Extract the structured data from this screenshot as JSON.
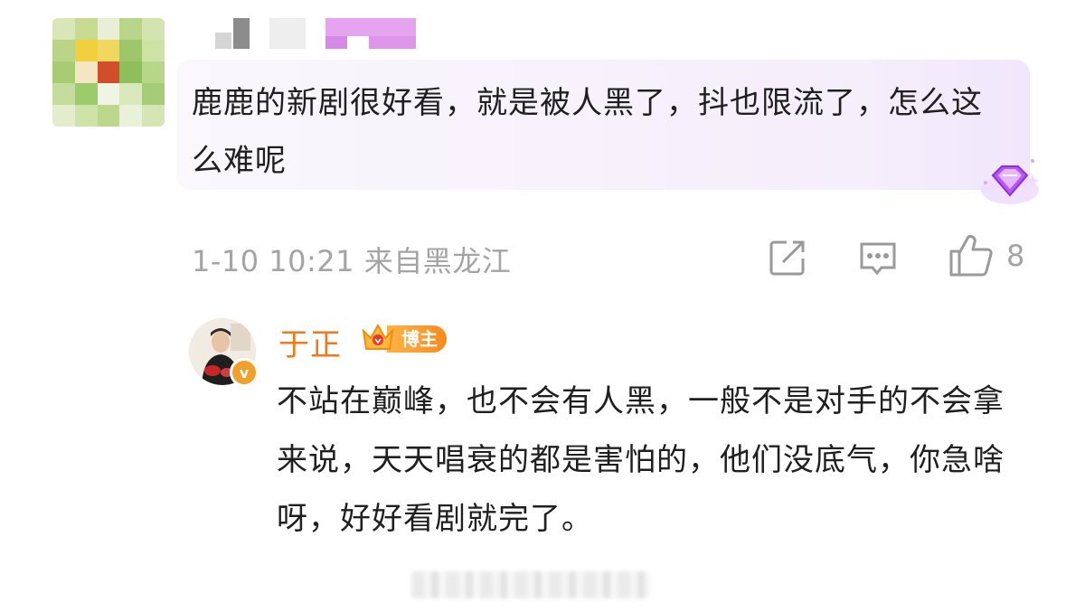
{
  "comment": {
    "text": "鹿鹿的新剧很好看，就是被人黑了，抖也限流了，怎么这么难呢",
    "meta": "1-10 10:21 来自黑龙江",
    "like_count": "8"
  },
  "reply": {
    "author_name": "于正",
    "author_tag": "博主",
    "verified_mark": "v",
    "text": "不站在巅峰，也不会有人黑，一般不是对手的不会拿来说，天天唱衰的都是害怕的，他们没底气，你急啥呀，好好看剧就完了。"
  },
  "icons": [
    "share-icon",
    "comment-icon",
    "like-icon",
    "gem-badge-icon",
    "crown-icon"
  ],
  "colors": {
    "bubble_bg": "#f5eefb",
    "reply_name": "#f07a1a",
    "meta_gray": "#a4a4a4",
    "tag_orange": "#f88a1e"
  }
}
